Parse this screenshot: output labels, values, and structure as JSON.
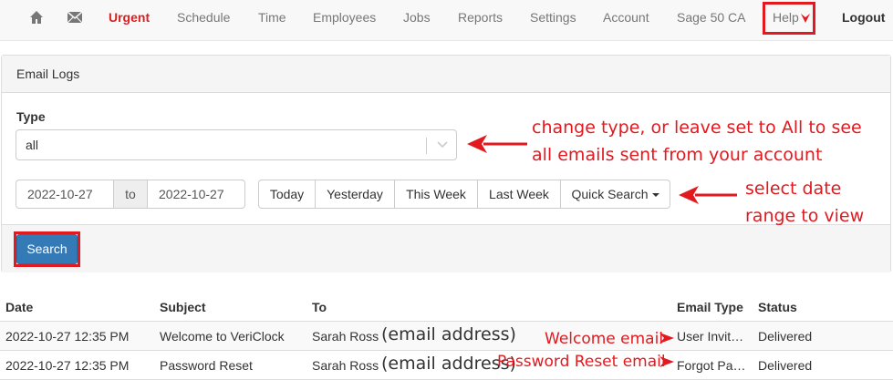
{
  "nav": {
    "items": [
      "Urgent",
      "Schedule",
      "Time",
      "Employees",
      "Jobs",
      "Reports",
      "Settings",
      "Account",
      "Sage 50 CA",
      "Help",
      "Logout"
    ],
    "icons": [
      "home-icon",
      "mail-icon"
    ]
  },
  "panel": {
    "title": "Email Logs"
  },
  "filter": {
    "type_label": "Type",
    "type_value": "all",
    "date_from": "2022-10-27",
    "date_sep": "to",
    "date_to": "2022-10-27",
    "range_buttons": [
      "Today",
      "Yesterday",
      "This Week",
      "Last Week",
      "Quick Search"
    ],
    "search_label": "Search"
  },
  "annotations": {
    "type_line1": "change type, or leave set to All to see",
    "type_line2": "all emails sent from your account",
    "range_line1": "select date",
    "range_line2": "range to view",
    "welcome": "Welcome email",
    "reset": "Password Reset email",
    "email_address": "(email address)"
  },
  "table": {
    "headers": [
      "Date",
      "Subject",
      "To",
      "Email Type",
      "Status"
    ],
    "rows": [
      {
        "date": "2022-10-27 12:35 PM",
        "subject": "Welcome to VeriClock",
        "to": "Sarah Ross",
        "type": "User Invit…",
        "status": "Delivered"
      },
      {
        "date": "2022-10-27 12:35 PM",
        "subject": "Password Reset",
        "to": "Sarah Ross",
        "type": "Forgot Pa…",
        "status": "Delivered"
      }
    ]
  },
  "colors": {
    "accent_red": "#e2191f",
    "primary_blue": "#337ab7",
    "urgent_red": "#d9201f"
  }
}
